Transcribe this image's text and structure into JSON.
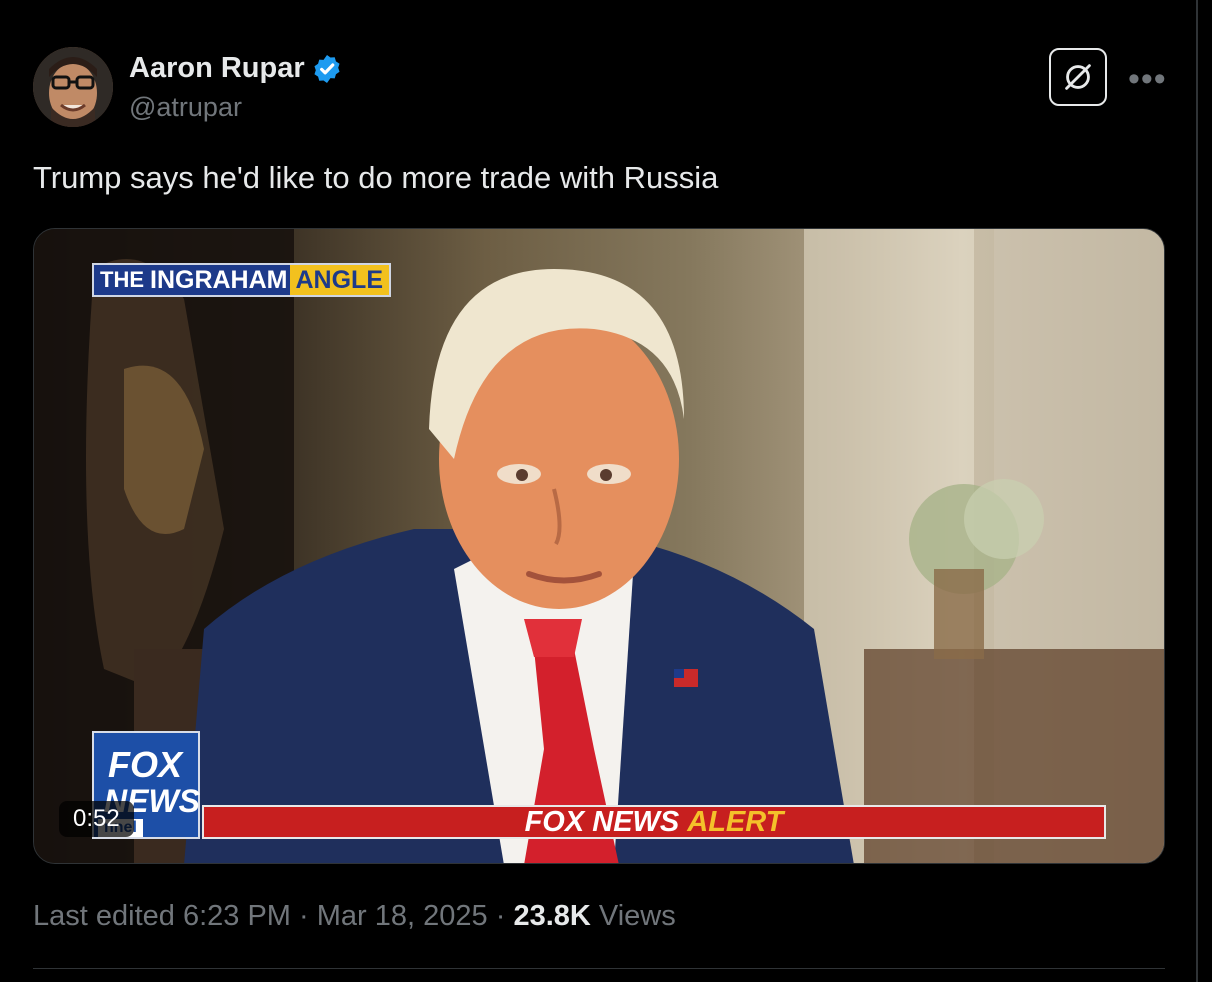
{
  "tweet": {
    "author_name": "Aaron Rupar",
    "author_handle": "@atrupar",
    "verified": true,
    "text": "Trump says he'd like to do more trade with Russia"
  },
  "media": {
    "duration": "0:52",
    "show_logo": {
      "prefix": "THE",
      "main": "INGRAHAM",
      "highlight": "ANGLE"
    },
    "channel_bug": {
      "line1": "FOX",
      "line2": "NEWS",
      "line3": "nnel"
    },
    "ticker": {
      "brand": "FOX NEWS",
      "alert": "ALERT"
    }
  },
  "meta": {
    "edited_label": "Last edited 6:23 PM",
    "separator": "·",
    "date": "Mar 18, 2025",
    "views_count": "23.8K",
    "views_label": "Views"
  },
  "icons": {
    "verified": "verified-badge-icon",
    "grok": "grok-icon",
    "more": "more-options-icon"
  },
  "colors": {
    "background": "#000000",
    "text_primary": "#e7e9ea",
    "text_secondary": "#71767b",
    "verified_blue": "#1d9bf0",
    "ticker_red": "#c71f1f",
    "alert_yellow": "#f4c12a",
    "fox_blue": "#1d4fa7"
  }
}
